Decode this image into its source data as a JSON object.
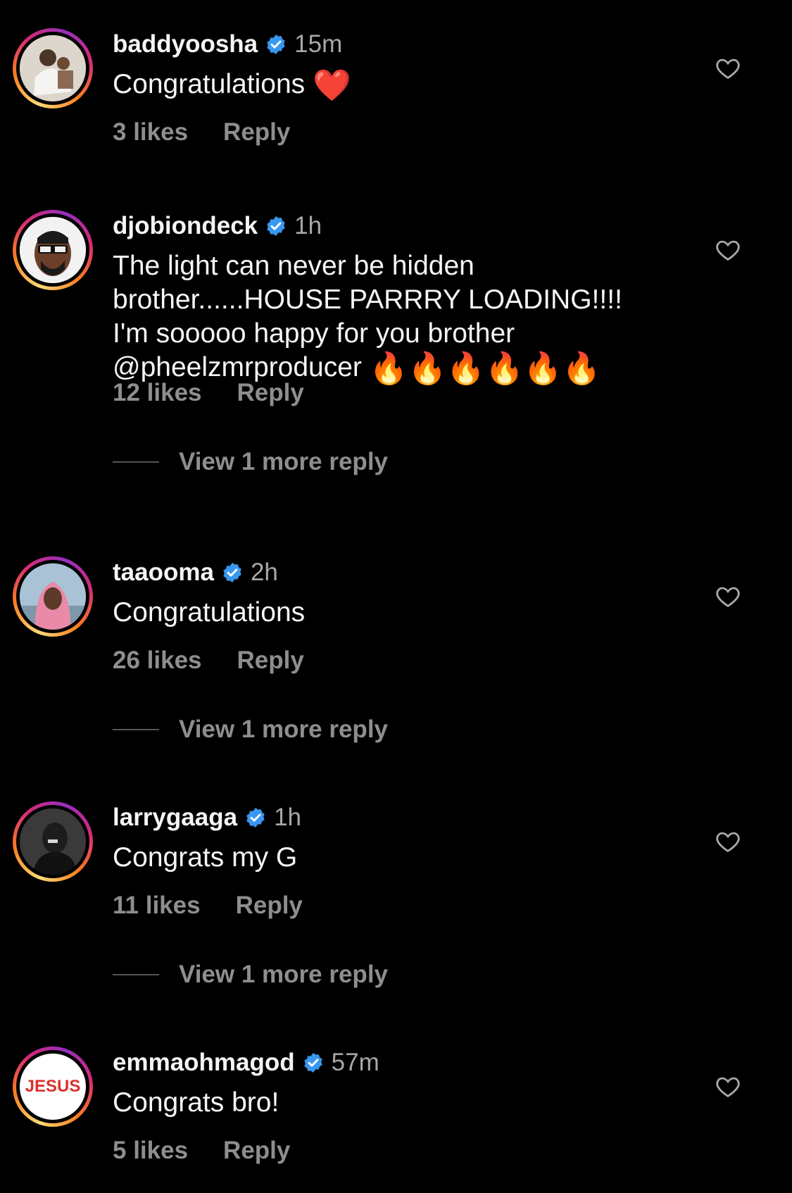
{
  "comments": [
    {
      "username": "baddyoosha",
      "time": "15m",
      "text": "Congratulations",
      "emoji": "❤️",
      "likes": "3 likes",
      "reply": "Reply"
    },
    {
      "username": "djobiondeck",
      "time": "1h",
      "line1": "The light can never be hidden",
      "line2": "brother......HOUSE PARRRY LOADING!!!!",
      "line3": "I'm sooooo happy for you brother",
      "mention": "@pheelzmrproducer",
      "emoji": "🔥🔥🔥🔥🔥🔥",
      "likes": "12 likes",
      "reply": "Reply",
      "view_more": "View 1 more reply"
    },
    {
      "username": "taaooma",
      "time": "2h",
      "text": "Congratulations",
      "likes": "26 likes",
      "reply": "Reply",
      "view_more": "View 1 more reply"
    },
    {
      "username": "larrygaaga",
      "time": "1h",
      "text": "Congrats my G",
      "likes": "11 likes",
      "reply": "Reply",
      "view_more": "View 1 more reply"
    },
    {
      "username": "emmaohmagod",
      "time": "57m",
      "text": "Congrats bro!",
      "avatar_text": "JESUS",
      "likes": "5 likes",
      "reply": "Reply"
    }
  ],
  "colors": {
    "background": "#000000",
    "verified": "#3897f0",
    "secondary": "#8e8e8e"
  },
  "icons": [
    "verified-badge-icon",
    "heart-outline-icon"
  ]
}
